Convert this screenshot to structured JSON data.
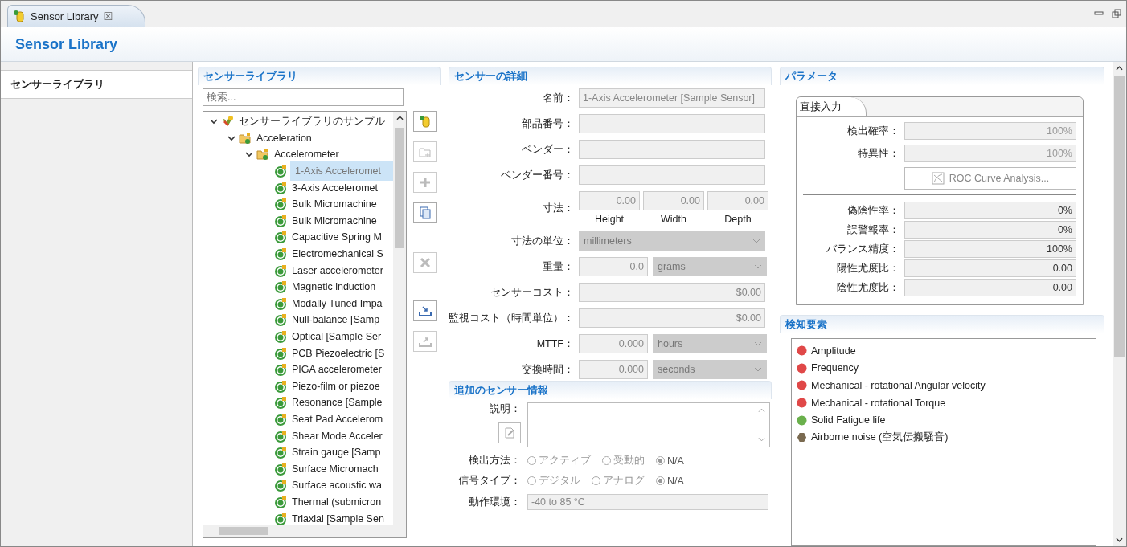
{
  "editor_tab": {
    "label": "Sensor Library",
    "close": "☒"
  },
  "header": {
    "title": "Sensor Library"
  },
  "nav": {
    "items": [
      {
        "label": "センサーライブラリ",
        "selected": true
      }
    ]
  },
  "library": {
    "title": "センサーライブラリ",
    "search": {
      "placeholder": "検索..."
    },
    "tree": [
      {
        "label": "センサーライブラリのサンプル",
        "kind": "library",
        "expanded": true,
        "children": [
          {
            "label": "Acceleration",
            "kind": "folder",
            "expanded": true,
            "children": [
              {
                "label": "Accelerometer",
                "kind": "folder",
                "expanded": true,
                "children": [
                  {
                    "label": "1-Axis Acceleromet",
                    "kind": "sensor",
                    "selected": true
                  },
                  {
                    "label": "3-Axis Acceleromet",
                    "kind": "sensor",
                    "selected": false
                  },
                  {
                    "label": "Bulk Micromachine",
                    "kind": "sensor",
                    "selected": false
                  },
                  {
                    "label": "Bulk Micromachine",
                    "kind": "sensor",
                    "selected": false
                  },
                  {
                    "label": "Capacitive Spring M",
                    "kind": "sensor",
                    "selected": false
                  },
                  {
                    "label": "Electromechanical S",
                    "kind": "sensor",
                    "selected": false
                  },
                  {
                    "label": "Laser accelerometer",
                    "kind": "sensor",
                    "selected": false
                  },
                  {
                    "label": "Magnetic induction",
                    "kind": "sensor",
                    "selected": false
                  },
                  {
                    "label": "Modally Tuned Impa",
                    "kind": "sensor",
                    "selected": false
                  },
                  {
                    "label": "Null-balance [Samp",
                    "kind": "sensor",
                    "selected": false
                  },
                  {
                    "label": "Optical [Sample Ser",
                    "kind": "sensor",
                    "selected": false
                  },
                  {
                    "label": "PCB Piezoelectric [S",
                    "kind": "sensor",
                    "selected": false
                  },
                  {
                    "label": "PIGA accelerometer",
                    "kind": "sensor",
                    "selected": false
                  },
                  {
                    "label": "Piezo-film or piezoe",
                    "kind": "sensor",
                    "selected": false
                  },
                  {
                    "label": "Resonance [Sample",
                    "kind": "sensor",
                    "selected": false
                  },
                  {
                    "label": "Seat Pad Accelerom",
                    "kind": "sensor",
                    "selected": false
                  },
                  {
                    "label": "Shear Mode Acceler",
                    "kind": "sensor",
                    "selected": false
                  },
                  {
                    "label": "Strain gauge [Samp",
                    "kind": "sensor",
                    "selected": false
                  },
                  {
                    "label": "Surface Micromach",
                    "kind": "sensor",
                    "selected": false
                  },
                  {
                    "label": "Surface acoustic wa",
                    "kind": "sensor",
                    "selected": false
                  },
                  {
                    "label": "Thermal (submicron",
                    "kind": "sensor",
                    "selected": false
                  },
                  {
                    "label": "Triaxial [Sample Sen",
                    "kind": "sensor",
                    "selected": false
                  }
                ]
              }
            ]
          }
        ]
      }
    ],
    "tools": [
      {
        "kind": "add-sensor",
        "disabled": false
      },
      {
        "kind": "add-folder",
        "disabled": true
      },
      {
        "kind": "add",
        "disabled": true
      },
      {
        "kind": "copy",
        "disabled": false
      },
      {
        "kind": "delete",
        "disabled": true
      },
      {
        "kind": "import",
        "disabled": false
      },
      {
        "kind": "export",
        "disabled": true
      }
    ]
  },
  "details": {
    "title": "センサーの詳細",
    "rows": [
      {
        "kind": "text",
        "label": "名前：",
        "value": "1-Axis Accelerometer [Sample Sensor]"
      },
      {
        "kind": "text",
        "label": "部品番号："
      },
      {
        "kind": "text",
        "label": "ベンダー："
      },
      {
        "kind": "text",
        "label": "ベンダー番号："
      },
      {
        "kind": "dims",
        "label": "寸法：",
        "values": [
          "0.00",
          "0.00",
          "0.00"
        ],
        "captions": [
          "Height",
          "Width",
          "Depth"
        ]
      },
      {
        "kind": "select",
        "label": "寸法の単位：",
        "value": "millimeters"
      },
      {
        "kind": "number-select",
        "label": "重量：",
        "value": "0.0",
        "unit": "grams"
      },
      {
        "kind": "number",
        "label": "センサーコスト：",
        "value": "$0.00"
      },
      {
        "kind": "number",
        "label": "監視コスト（時間単位）：",
        "value": "$0.00"
      },
      {
        "kind": "number-select",
        "label": "MTTF：",
        "value": "0.000",
        "unit": "hours"
      },
      {
        "kind": "number-select",
        "label": "交換時間：",
        "value": "0.000",
        "unit": "seconds"
      }
    ]
  },
  "additional": {
    "title": "追加のセンサー情報",
    "description_label": "説明：",
    "radios": [
      {
        "label": "検出方法：",
        "options": [
          {
            "label": "アクティブ",
            "selected": false
          },
          {
            "label": "受動的",
            "selected": false
          },
          {
            "label": "N/A",
            "selected": true
          }
        ]
      },
      {
        "label": "信号タイプ：",
        "options": [
          {
            "label": "デジタル",
            "selected": false
          },
          {
            "label": "アナログ",
            "selected": false
          },
          {
            "label": "N/A",
            "selected": true
          }
        ]
      }
    ],
    "environment": {
      "label": "動作環境：",
      "value": "-40 to 85 °C"
    }
  },
  "parameters": {
    "title": "パラメータ",
    "tab": "直接入力",
    "top_rows": [
      {
        "label": "検出確率：",
        "value": "100%"
      },
      {
        "label": "特異性：",
        "value": "100%"
      }
    ],
    "roc_button": "ROC Curve Analysis...",
    "bottom_rows": [
      {
        "label": "偽陰性率：",
        "value": "0%"
      },
      {
        "label": "誤警報率：",
        "value": "0%"
      },
      {
        "label": "バランス精度：",
        "value": "100%"
      },
      {
        "label": "陽性尤度比：",
        "value": "0.00"
      },
      {
        "label": "陰性尤度比：",
        "value": "0.00"
      }
    ]
  },
  "factors": {
    "title": "検知要素",
    "items": [
      {
        "label": "Amplitude",
        "color": "#e04848",
        "kind": "circle"
      },
      {
        "label": "Frequency",
        "color": "#e04848",
        "kind": "circle"
      },
      {
        "label": "Mechanical - rotational Angular velocity",
        "color": "#e04848",
        "kind": "circle"
      },
      {
        "label": "Mechanical - rotational Torque",
        "color": "#e04848",
        "kind": "circle"
      },
      {
        "label": "Solid Fatigue life",
        "color": "#6ab04c",
        "kind": "circle"
      },
      {
        "label": "Airborne noise (空気伝搬騒音)",
        "color": "#7a6a50",
        "kind": "hexagon"
      }
    ]
  }
}
